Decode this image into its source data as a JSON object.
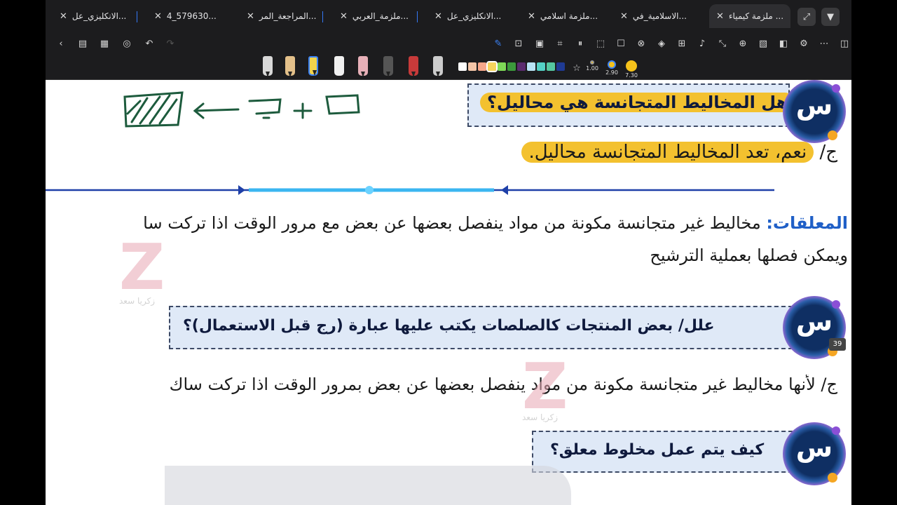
{
  "tabs": [
    {
      "label": "ملزمة كيمياء ...",
      "active": true
    },
    {
      "label": "الاسلامية_في...",
      "active": false
    },
    {
      "label": "ملزمة اسلامي...",
      "active": false
    },
    {
      "label": "الانكليزي_عل...",
      "active": false
    },
    {
      "label": "ملزمة_العربي...",
      "active": false
    },
    {
      "label": "المراجعة_المر...",
      "active": false
    },
    {
      "label": "4_579630...",
      "active": false
    },
    {
      "label": "الانكليزي_عل...",
      "active": false
    }
  ],
  "tab_controls": {
    "dropdown_icon": "chevron-down-icon",
    "expand_icon": "expand-icon"
  },
  "toolbar_icons": [
    "back-icon",
    "sidebar-icon",
    "grid-icon",
    "target-icon",
    "undo-icon",
    "redo-icon",
    "pen-icon",
    "text-box-icon",
    "image-icon",
    "crop-icon",
    "split-icon",
    "select-icon",
    "comment-icon",
    "link-icon",
    "layers-icon",
    "mic-icon",
    "zoom-icon",
    "add-page-icon",
    "pattern-icon",
    "reader-icon",
    "settings-icon",
    "more-icon",
    "panel-icon"
  ],
  "pen_tray": {
    "swatch_colors": [
      "#ffffff",
      "#f4c6a8",
      "#f7a78a",
      "#f6d55c",
      "#7ed957",
      "#3c9a3c",
      "#5b2c6f",
      "#b8e4f6",
      "#54d1c5",
      "#55c7a0",
      "#1f3a93"
    ],
    "sizes": [
      "1.00",
      "2.90",
      "7.30"
    ]
  },
  "document": {
    "q1": "هل المخاليط المتجانسة هي محاليل؟",
    "a1_prefix": "ج/",
    "a1": "نعم، تعد المخاليط المتجانسة محاليل.",
    "def_term": "المعلقات:",
    "def_text_line1": "مخاليط غير متجانسة مكونة من مواد ينفصل بعضها عن بعض مع مرور الوقت اذا تركت سا",
    "def_text_line2": "ويمكن فصلها بعملية الترشيح",
    "q2": "علل/ بعض المنتجات كالصلصات يكتب عليها عبارة (رج قبل الاستعمال)؟",
    "a2": "ج/ لأنها مخاليط غير متجانسة مكونة من مواد ينفصل بعضها عن بعض بمرور الوقت اذا تركت ساك",
    "q3": "كيف يتم عمل مخلوط معلق؟",
    "badge_letter": "س",
    "watermark_letter": "Z",
    "watermark_name": "زكريا سعد",
    "page_number": "39"
  }
}
